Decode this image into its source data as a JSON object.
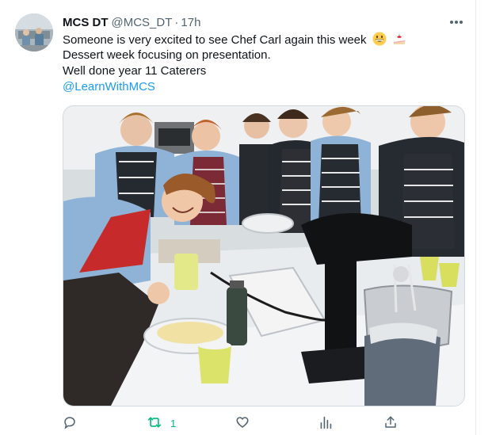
{
  "tweet": {
    "display_name": "MCS DT",
    "handle": "@MCS_DT",
    "separator": "·",
    "time": "17h",
    "lines": [
      "Someone is very excited to see Chef Carl again this week",
      "Dessert week focusing on presentation.",
      "Well done year 11 Caterers"
    ],
    "emojis": [
      "grinning-face",
      "shortcake"
    ],
    "mention": "@LearnWithMCS",
    "more_icon": "ellipsis-icon"
  },
  "actions": {
    "reply": {
      "icon": "reply-icon",
      "count": ""
    },
    "retweet": {
      "icon": "retweet-icon",
      "count": "1",
      "color": "#00ba7c"
    },
    "like": {
      "icon": "heart-icon",
      "count": ""
    },
    "analytics": {
      "icon": "analytics-icon"
    },
    "share": {
      "icon": "share-icon"
    }
  },
  "colors": {
    "link": "#1d9bf0",
    "secondary_text": "#536471",
    "retweet_active": "#00ba7c"
  }
}
